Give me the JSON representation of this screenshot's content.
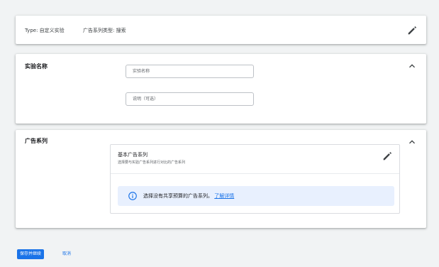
{
  "experiment_summary": {
    "type_label": "Type:",
    "type_value": "自定义实验",
    "campaign_type_label": "广告系列类型:",
    "campaign_type_value": "搜索"
  },
  "name_section": {
    "title": "实验名称",
    "name_placeholder": "实验名称",
    "description_placeholder": "说明（可选）"
  },
  "campaign_section": {
    "title": "广告系列",
    "base_campaign_title": "基本广告系列",
    "base_campaign_subtitle": "选择要与实验广告系列进行对比的广告系列",
    "info_text": "选择没有共享预算的广告系列。",
    "info_link": "了解详情"
  },
  "footer": {
    "save_label": "保存并继续",
    "cancel_label": "取消"
  },
  "colors": {
    "accent": "#1a73e8",
    "info_bg": "#e8f0fe",
    "page_bg": "#f1f3f4"
  }
}
